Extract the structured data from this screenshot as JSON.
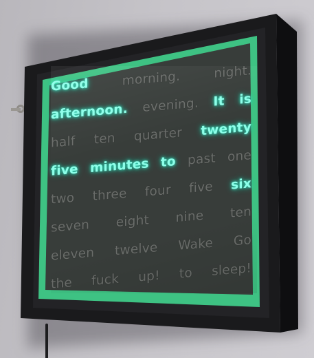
{
  "scene": {
    "subject": "word-clock"
  },
  "colors": {
    "wall": "#c4c2c7",
    "frame": "#161618",
    "mat_green": "#3ec283",
    "panel": "#3e4240",
    "lit_text": "#8dffe9",
    "unlit_text": "#6a6d6a"
  },
  "word_clock": {
    "rows": [
      {
        "words": [
          {
            "text": "Good",
            "lit": true
          },
          {
            "text": "morning.",
            "lit": false
          },
          {
            "text": "night.",
            "lit": false
          }
        ]
      },
      {
        "words": [
          {
            "text": "afternoon.",
            "lit": true
          },
          {
            "text": "evening.",
            "lit": false
          },
          {
            "text": "It",
            "lit": true
          },
          {
            "text": "is",
            "lit": true
          }
        ]
      },
      {
        "words": [
          {
            "text": "half",
            "lit": false
          },
          {
            "text": "ten",
            "lit": false
          },
          {
            "text": "quarter",
            "lit": false
          },
          {
            "text": "twenty",
            "lit": true
          }
        ]
      },
      {
        "words": [
          {
            "text": "five",
            "lit": true
          },
          {
            "text": "minutes",
            "lit": true
          },
          {
            "text": "to",
            "lit": true
          },
          {
            "text": "past",
            "lit": false
          },
          {
            "text": "one",
            "lit": false
          }
        ]
      },
      {
        "words": [
          {
            "text": "two",
            "lit": false
          },
          {
            "text": "three",
            "lit": false
          },
          {
            "text": "four",
            "lit": false
          },
          {
            "text": "five",
            "lit": false
          },
          {
            "text": "six",
            "lit": true
          }
        ]
      },
      {
        "words": [
          {
            "text": "seven",
            "lit": false
          },
          {
            "text": "eight",
            "lit": false
          },
          {
            "text": "nine",
            "lit": false
          },
          {
            "text": "ten",
            "lit": false
          }
        ]
      },
      {
        "words": [
          {
            "text": "eleven",
            "lit": false
          },
          {
            "text": "twelve",
            "lit": false
          },
          {
            "text": "Wake",
            "lit": false
          },
          {
            "text": "Go",
            "lit": false
          }
        ]
      },
      {
        "words": [
          {
            "text": "the",
            "lit": false
          },
          {
            "text": "fuck",
            "lit": false
          },
          {
            "text": "up!",
            "lit": false
          },
          {
            "text": "to",
            "lit": false
          },
          {
            "text": "sleep!",
            "lit": false
          }
        ]
      }
    ]
  }
}
